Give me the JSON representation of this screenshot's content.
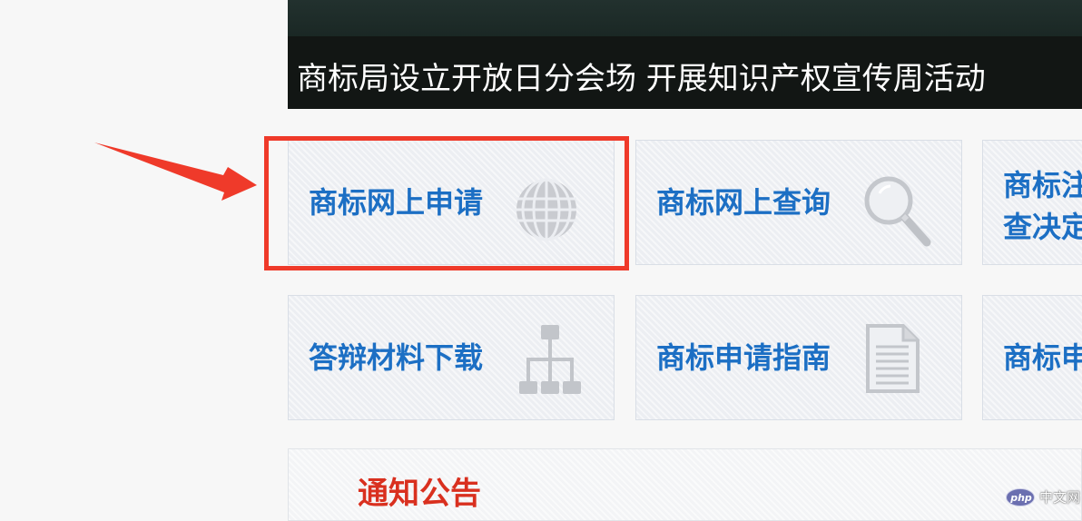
{
  "banner": {
    "caption": "商标局设立开放日分会场 开展知识产权宣传周活动"
  },
  "tiles": [
    {
      "label": "商标网上申请",
      "icon": "globe-icon"
    },
    {
      "label": "商标网上查询",
      "icon": "magnifier-icon"
    },
    {
      "label": "商标注\n查决定",
      "icon": ""
    },
    {
      "label": "答辩材料下载",
      "icon": "sitemap-icon"
    },
    {
      "label": "商标申请指南",
      "icon": "document-icon"
    },
    {
      "label": "商标申",
      "icon": ""
    }
  ],
  "notice": {
    "title": "通知公告"
  },
  "annotation": {
    "highlight_color": "#ef3a2a",
    "arrow_color": "#ef3a2a"
  },
  "watermark": {
    "logo_text": "php",
    "text": "中文网"
  }
}
